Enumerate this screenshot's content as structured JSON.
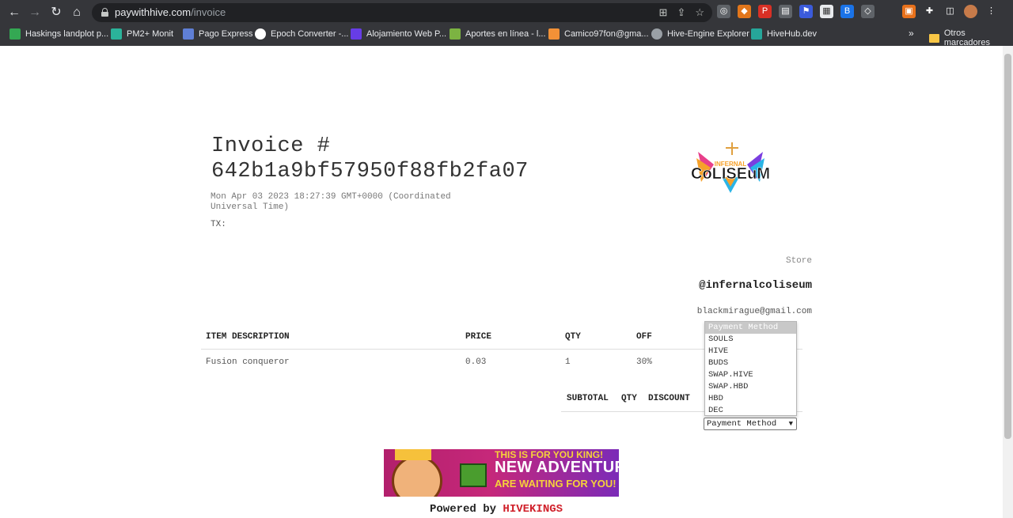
{
  "browser": {
    "url_domain": "paywithhive.com",
    "url_path": "/invoice",
    "bookmarks": [
      {
        "label": "Haskings landplot p...",
        "color": "#34a853"
      },
      {
        "label": "PM2+ Monit",
        "color": "#2bb39a"
      },
      {
        "label": "Pago Express",
        "color": "#5f7fd6"
      },
      {
        "label": "Epoch Converter -...",
        "color": "#ffffff"
      },
      {
        "label": "Alojamiento Web P...",
        "color": "#673de6"
      },
      {
        "label": "Aportes en línea - l...",
        "color": "#7cb342"
      },
      {
        "label": "Camico97fon@gma...",
        "color": "#f29137"
      },
      {
        "label": "Hive-Engine Explorer",
        "color": "#9aa0a6"
      },
      {
        "label": "HiveHub.dev",
        "color": "#26a69a"
      }
    ],
    "bookmarks_more": "»",
    "other_bookmarks": "Otros marcadores"
  },
  "invoice": {
    "title_line1": "Invoice #",
    "title_line2": "642b1a9bf57950f88fb2fa07",
    "date": "Mon Apr 03 2023 18:27:39 GMT+0000 (Coordinated Universal Time)",
    "tx_label": "TX:"
  },
  "logo": {
    "small": "INFERNAL",
    "big": "CoLISEuM"
  },
  "store": {
    "label": "Store",
    "name": "@infernalcoliseum",
    "email": "blackmirague@gmail.com"
  },
  "table": {
    "headers": [
      "ITEM DESCRIPTION",
      "PRICE",
      "QTY",
      "OFF"
    ],
    "rows": [
      [
        "Fusion conqueror",
        "0.03",
        "1",
        "30%"
      ]
    ]
  },
  "summary": {
    "headers": [
      "SUBTOTAL",
      "QTY",
      "DISCOUNT"
    ]
  },
  "payment": {
    "selected": "Payment Method",
    "options": [
      "Payment Method",
      "SOULS",
      "HIVE",
      "BUDS",
      "SWAP.HIVE",
      "SWAP.HBD",
      "HBD",
      "DEC"
    ]
  },
  "banner": {
    "top": "THIS IS FOR YOU KING!",
    "middle": "NEW ADVENTURES",
    "bottom": "ARE WAITING FOR YOU!"
  },
  "footer": {
    "powered_by": "Powered by",
    "brand": "HIVEKINGS"
  }
}
